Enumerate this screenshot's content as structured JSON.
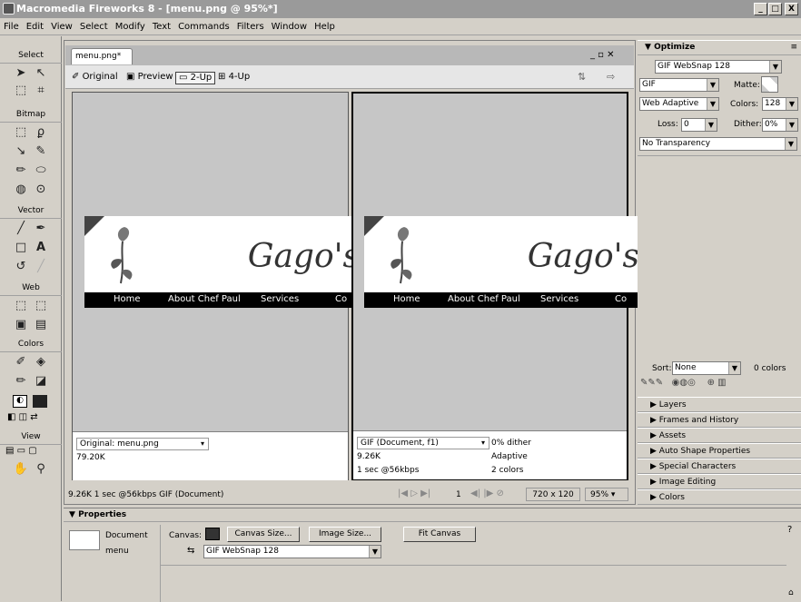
{
  "window": {
    "title": "Macromedia Fireworks 8 - [menu.png @ 95%*]",
    "min": "_",
    "max": "□",
    "close": "X"
  },
  "menu": [
    "File",
    "Edit",
    "View",
    "Select",
    "Modify",
    "Text",
    "Commands",
    "Filters",
    "Window",
    "Help"
  ],
  "toolbox": {
    "sections": [
      "Select",
      "Bitmap",
      "Vector",
      "Web",
      "Colors",
      "View"
    ]
  },
  "document": {
    "tab": "menu.png*",
    "view_buttons": {
      "original": "Original",
      "preview": "Preview",
      "two_up": "2-Up",
      "four_up": "4-Up"
    },
    "canvas_title": "Gago's",
    "nav": [
      "Home",
      "About Chef Paul",
      "Services",
      "Co"
    ],
    "left_info": {
      "format": "Original: menu.png",
      "size": "79.20K"
    },
    "right_info": {
      "format": "GIF (Document, f1)",
      "dither": "0% dither",
      "size": "9.26K",
      "palette": "Adaptive",
      "time": "1 sec @56kbps",
      "colors": "2 colors"
    },
    "status": {
      "summary": "9.26K 1 sec @56kbps GIF (Document)",
      "frame": "1",
      "dimensions": "720 x 120",
      "zoom": "95%"
    }
  },
  "optimize": {
    "title": "Optimize",
    "preset": "GIF WebSnap 128",
    "format": "GIF",
    "matte_label": "Matte:",
    "palette": "Web Adaptive",
    "colors_label": "Colors:",
    "colors": "128",
    "loss_label": "Loss:",
    "loss": "0",
    "dither_label": "Dither:",
    "dither": "0%",
    "transparency": "No Transparency",
    "sort_label": "Sort:",
    "sort": "None",
    "color_count": "0 colors"
  },
  "panels": [
    "Layers",
    "Frames and History",
    "Assets",
    "Auto Shape Properties",
    "Special Characters",
    "Image Editing",
    "Colors"
  ],
  "properties": {
    "title": "Properties",
    "doc_label": "Document",
    "doc_name": "menu",
    "canvas_label": "Canvas:",
    "canvas_size": "Canvas Size...",
    "image_size": "Image Size...",
    "fit_canvas": "Fit Canvas",
    "preset": "GIF WebSnap 128"
  }
}
